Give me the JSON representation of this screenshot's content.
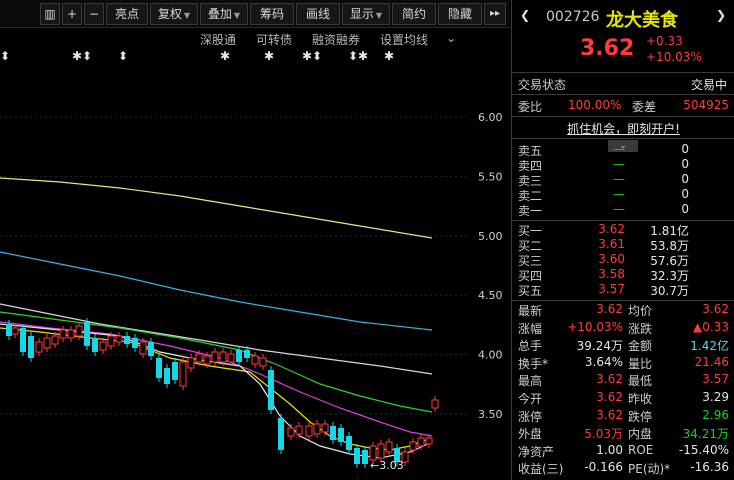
{
  "toolbar": {
    "buttons": [
      {
        "label": "▥",
        "icon": "grid-icon"
      },
      {
        "label": "+"
      },
      {
        "label": "−"
      },
      {
        "label": "亮点"
      },
      {
        "label": "复权"
      },
      {
        "label": "叠加"
      },
      {
        "label": "筹码"
      },
      {
        "label": "画线"
      },
      {
        "label": "显示"
      },
      {
        "label": "简约"
      },
      {
        "label": "隐藏"
      },
      {
        "label": "▸▸"
      }
    ]
  },
  "indicators": {
    "items": [
      "深股通",
      "可转债",
      "融资融券",
      "设置均线"
    ],
    "more": "⌄"
  },
  "chart": {
    "y_axis_labels": [
      "6.00",
      "5.50",
      "5.00",
      "4.50",
      "4.00",
      "3.50"
    ],
    "low_annotation": "←3.03",
    "colors": {
      "up": "#ff3b3b",
      "down": "#19d6e6",
      "ma_white": "#e8e8e8",
      "ma_yellow": "#e6e600",
      "ma_magenta": "#e040e0",
      "ma_green": "#30d030",
      "ma_light": "#d8d8d8",
      "ma_yellow_long": "#e6e680",
      "ma_cyan_long": "#40b0e0"
    }
  },
  "panel": {
    "code": "002726",
    "name": "龙大美食",
    "price": "3.62",
    "change": "+0.33",
    "change_pct": "+10.03%",
    "status_label": "交易状态",
    "status_value": "交易中",
    "weibi_label": "委比",
    "weibi_value": "100.00%",
    "weicha_label": "委差",
    "weicha_value": "504925",
    "promo": "抓住机会，即刻开户!",
    "sell": [
      {
        "label": "卖五",
        "price": "—",
        "vol": "0"
      },
      {
        "label": "卖四",
        "price": "—",
        "vol": "0"
      },
      {
        "label": "卖三",
        "price": "—",
        "vol": "0"
      },
      {
        "label": "卖二",
        "price": "—",
        "vol": "0"
      },
      {
        "label": "卖一",
        "price": "—",
        "vol": "0"
      }
    ],
    "buy": [
      {
        "label": "买一",
        "price": "3.62",
        "vol": "1.81亿"
      },
      {
        "label": "买二",
        "price": "3.61",
        "vol": "53.8万"
      },
      {
        "label": "买三",
        "price": "3.60",
        "vol": "57.6万"
      },
      {
        "label": "买四",
        "price": "3.58",
        "vol": "32.3万"
      },
      {
        "label": "买五",
        "price": "3.57",
        "vol": "30.7万"
      }
    ],
    "stats": [
      {
        "l1": "最新",
        "v1": "3.62",
        "c1": "red",
        "l2": "均价",
        "v2": "3.62",
        "c2": "red"
      },
      {
        "l1": "涨幅",
        "v1": "+10.03%",
        "c1": "red",
        "l2": "涨跌",
        "v2": "▲0.33",
        "c2": "red"
      },
      {
        "l1": "总手",
        "v1": "39.24万",
        "c1": "white",
        "l2": "金额",
        "v2": "1.42亿",
        "c2": "cyan"
      },
      {
        "l1": "换手*",
        "v1": "3.64%",
        "c1": "white",
        "l2": "量比",
        "v2": "21.46",
        "c2": "red"
      },
      {
        "l1": "最高",
        "v1": "3.62",
        "c1": "red",
        "l2": "最低",
        "v2": "3.57",
        "c2": "red"
      },
      {
        "l1": "今开",
        "v1": "3.62",
        "c1": "red",
        "l2": "昨收",
        "v2": "3.29",
        "c2": "white"
      },
      {
        "l1": "涨停",
        "v1": "3.62",
        "c1": "red",
        "l2": "跌停",
        "v2": "2.96",
        "c2": "green"
      },
      {
        "l1": "外盘",
        "v1": "5.03万",
        "c1": "red",
        "l2": "内盘",
        "v2": "34.21万",
        "c2": "green"
      },
      {
        "l1": "净资产",
        "v1": "1.00",
        "c1": "white",
        "l2": "ROE",
        "v2": "-15.40%",
        "c2": "white"
      },
      {
        "l1": "收益(三)",
        "v1": "-0.166",
        "c1": "white",
        "l2": "PE(动)*",
        "v2": "-16.36",
        "c2": "white"
      }
    ]
  }
}
